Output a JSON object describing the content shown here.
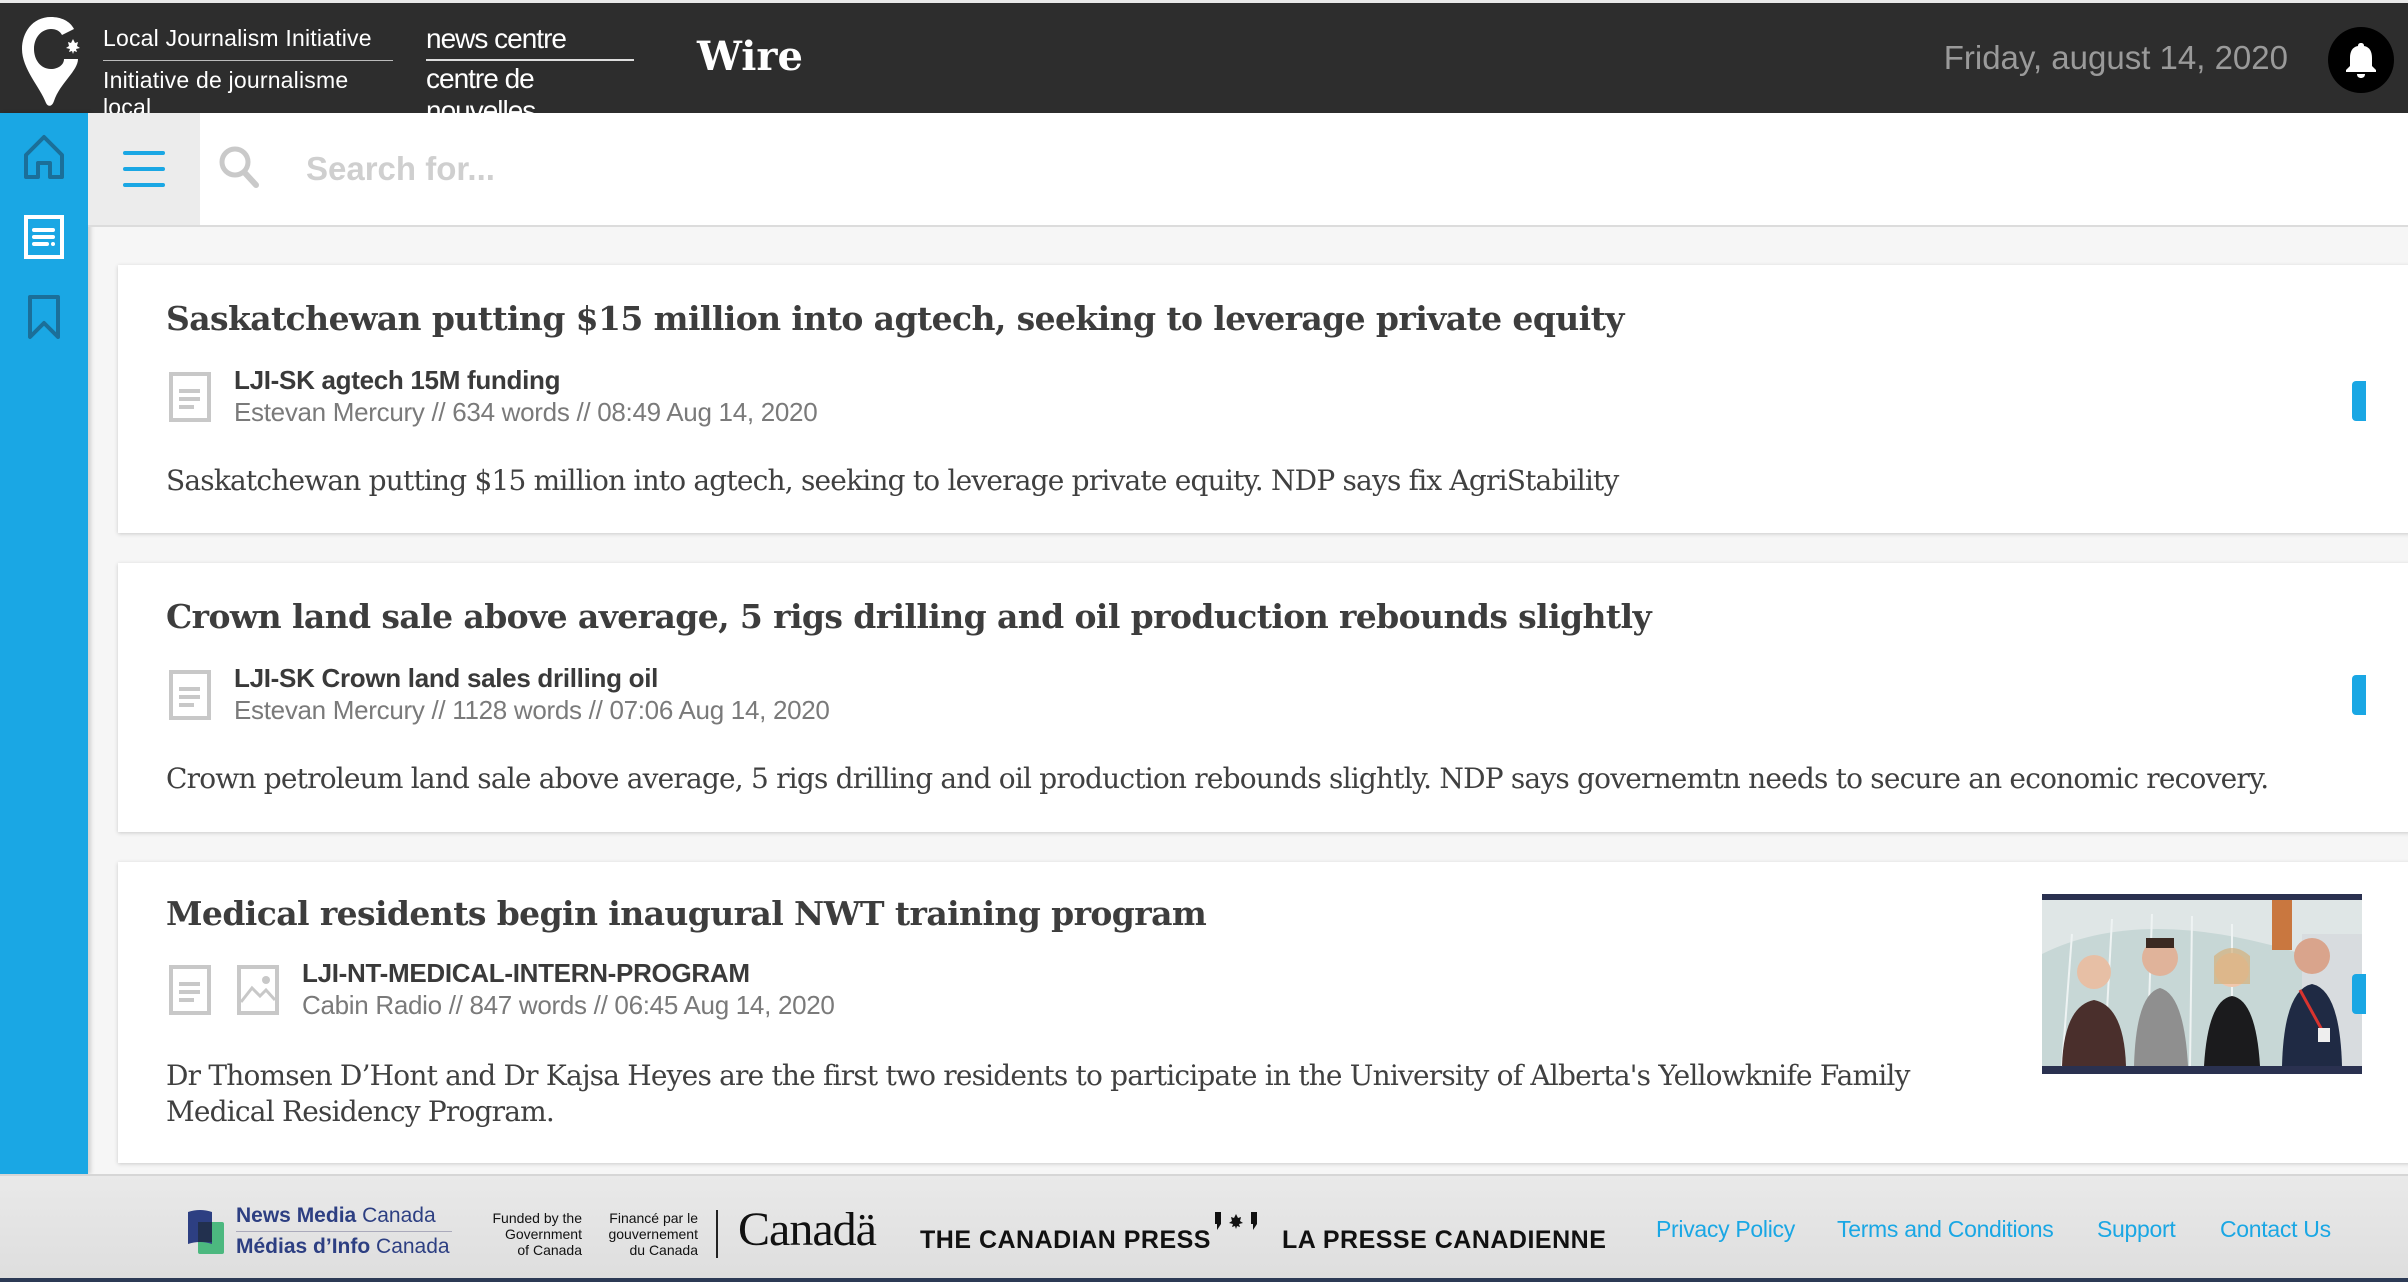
{
  "header": {
    "lji_line1": "Local Journalism Initiative",
    "lji_line2": "Initiative de journalisme local",
    "newscentre_line1": "news centre",
    "newscentre_line2": "centre de nouvelles",
    "app_title": "Wire",
    "date": "Friday, august 14, 2020",
    "notification_icon": "bell-icon"
  },
  "sidebar": {
    "items": [
      {
        "name": "home",
        "icon": "home-icon",
        "active": false
      },
      {
        "name": "stories",
        "icon": "document-icon",
        "active": true
      },
      {
        "name": "bookmarks",
        "icon": "bookmark-icon",
        "active": false
      }
    ]
  },
  "search": {
    "menu_icon": "hamburger-menu-icon",
    "icon": "search-icon",
    "placeholder": "Search for...",
    "value": ""
  },
  "articles": [
    {
      "title": "Saskatchewan putting $15 million into agtech, seeking to leverage private equity",
      "slug": "LJI-SK agtech 15M funding",
      "meta": "Estevan Mercury // 634 words // 08:49 Aug 14, 2020",
      "source": "Estevan Mercury",
      "words": "634 words",
      "time": "08:49 Aug 14, 2020",
      "summary": "Saskatchewan putting $15 million into agtech, seeking to leverage private equity. NDP says fix AgriStability",
      "has_image": false
    },
    {
      "title": "Crown land sale above average, 5 rigs drilling and oil production rebounds slightly",
      "slug": "LJI-SK Crown land sales drilling oil",
      "meta": "Estevan Mercury // 1128 words // 07:06 Aug 14, 2020",
      "source": "Estevan Mercury",
      "words": "1128 words",
      "time": "07:06 Aug 14, 2020",
      "summary": "Crown petroleum land sale above average, 5 rigs drilling and oil production rebounds slightly. NDP says governemtn needs to secure an economic recovery.",
      "has_image": false
    },
    {
      "title": "Medical residents begin inaugural NWT training program",
      "slug": "LJI-NT-MEDICAL-INTERN-PROGRAM",
      "meta": "Cabin Radio // 847 words // 06:45 Aug 14, 2020",
      "source": "Cabin Radio",
      "words": "847 words",
      "time": "06:45 Aug 14, 2020",
      "summary": "Dr Thomsen D’Hont and Dr Kajsa Heyes are the first two residents to participate in the University of Alberta's Yellowknife Family Medical Residency Program.",
      "has_image": true,
      "thumbnail_alt": "Four people standing in front of a glass building"
    }
  ],
  "footer": {
    "nmc_line1_bold": "News Media",
    "nmc_line1_light": "Canada",
    "nmc_line2_bold": "Médias d’Info",
    "nmc_line2_light": "Canada",
    "gov_en": [
      "Funded by the",
      "Government",
      "of Canada"
    ],
    "gov_fr": [
      "Financé par le",
      "gouvernement",
      "du Canada"
    ],
    "canada_wordmark": "Canadä",
    "cp_en": "THE CANADIAN PRESS",
    "cp_fr": "LA PRESSE CANADIENNE",
    "links": [
      "Privacy Policy",
      "Terms and Conditions",
      "Support",
      "Contact Us"
    ]
  },
  "colors": {
    "accent": "#1aa7e4",
    "header_bg": "#2d2d2d",
    "nmc_blue": "#2d3f82",
    "nmc_green": "#4cb87f"
  }
}
